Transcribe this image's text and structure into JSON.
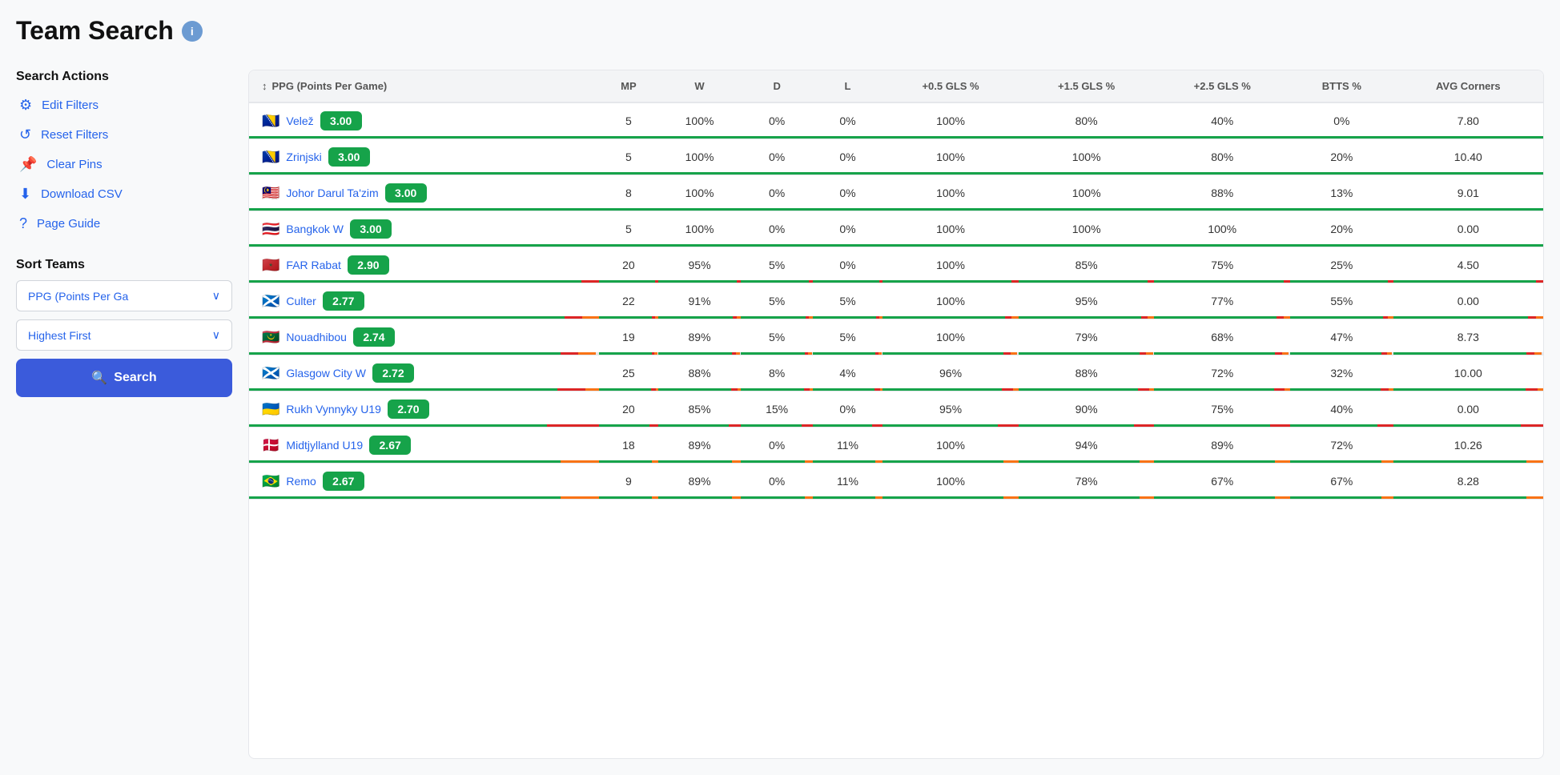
{
  "title": "Team Search",
  "info_icon_label": "i",
  "sidebar": {
    "search_actions_title": "Search Actions",
    "actions": [
      {
        "id": "edit-filters",
        "icon": "⚙",
        "label": "Edit Filters"
      },
      {
        "id": "reset-filters",
        "icon": "↺",
        "label": "Reset Filters"
      },
      {
        "id": "clear-pins",
        "icon": "📌",
        "label": "Clear Pins"
      },
      {
        "id": "download-csv",
        "icon": "⬇",
        "label": "Download CSV"
      },
      {
        "id": "page-guide",
        "icon": "?",
        "label": "Page Guide"
      }
    ],
    "sort_section_title": "Sort Teams",
    "sort_by_label": "PPG (Points Per Ga",
    "sort_order_label": "Highest First",
    "search_button_label": "Search"
  },
  "table": {
    "sort_col_icon": "↕",
    "sort_col_label": "PPG (Points Per Game)",
    "columns": [
      "MP",
      "W",
      "D",
      "L",
      "+0.5 GLS %",
      "+1.5 GLS %",
      "+2.5 GLS %",
      "BTTS %",
      "AVG Corners"
    ],
    "rows": [
      {
        "flag": "🇧🇦",
        "team": "Velež",
        "ppg": "3.00",
        "ppg_color": "green",
        "mp": "5",
        "w": "100%",
        "d": "0%",
        "l": "0%",
        "gls05": "100%",
        "gls15": "80%",
        "gls25": "40%",
        "btts": "0%",
        "avg_corners": "7.80",
        "bar_green": 100,
        "bar_red": 0,
        "bar_orange": 0
      },
      {
        "flag": "🇧🇦",
        "team": "Zrinjski",
        "ppg": "3.00",
        "ppg_color": "green",
        "mp": "5",
        "w": "100%",
        "d": "0%",
        "l": "0%",
        "gls05": "100%",
        "gls15": "100%",
        "gls25": "80%",
        "btts": "20%",
        "avg_corners": "10.40",
        "bar_green": 100,
        "bar_red": 0,
        "bar_orange": 0
      },
      {
        "flag": "🇲🇾",
        "team": "Johor Darul Ta'zim",
        "ppg": "3.00",
        "ppg_color": "green",
        "mp": "8",
        "w": "100%",
        "d": "0%",
        "l": "0%",
        "gls05": "100%",
        "gls15": "100%",
        "gls25": "88%",
        "btts": "13%",
        "avg_corners": "9.01",
        "bar_green": 100,
        "bar_red": 0,
        "bar_orange": 0
      },
      {
        "flag": "🇹🇭",
        "team": "Bangkok W",
        "ppg": "3.00",
        "ppg_color": "green",
        "mp": "5",
        "w": "100%",
        "d": "0%",
        "l": "0%",
        "gls05": "100%",
        "gls15": "100%",
        "gls25": "100%",
        "btts": "20%",
        "avg_corners": "0.00",
        "bar_green": 100,
        "bar_red": 0,
        "bar_orange": 0
      },
      {
        "flag": "🇲🇦",
        "team": "FAR Rabat",
        "ppg": "2.90",
        "ppg_color": "green",
        "mp": "20",
        "w": "95%",
        "d": "5%",
        "l": "0%",
        "gls05": "100%",
        "gls15": "85%",
        "gls25": "75%",
        "btts": "25%",
        "avg_corners": "4.50",
        "bar_green": 95,
        "bar_red": 5,
        "bar_orange": 0
      },
      {
        "flag": "🏴󠁧󠁢󠁳󠁣󠁴󠁿",
        "team": "Culter",
        "ppg": "2.77",
        "ppg_color": "green",
        "mp": "22",
        "w": "91%",
        "d": "5%",
        "l": "5%",
        "gls05": "100%",
        "gls15": "95%",
        "gls25": "77%",
        "btts": "55%",
        "avg_corners": "0.00",
        "bar_green": 91,
        "bar_red": 5,
        "bar_orange": 5
      },
      {
        "flag": "🇲🇷",
        "team": "Nouadhibou",
        "ppg": "2.74",
        "ppg_color": "green",
        "mp": "19",
        "w": "89%",
        "d": "5%",
        "l": "5%",
        "gls05": "100%",
        "gls15": "79%",
        "gls25": "68%",
        "btts": "47%",
        "avg_corners": "8.73",
        "bar_green": 89,
        "bar_red": 5,
        "bar_orange": 5
      },
      {
        "flag": "🏴󠁧󠁢󠁳󠁣󠁴󠁿",
        "team": "Glasgow City W",
        "ppg": "2.72",
        "ppg_color": "green",
        "mp": "25",
        "w": "88%",
        "d": "8%",
        "l": "4%",
        "gls05": "96%",
        "gls15": "88%",
        "gls25": "72%",
        "btts": "32%",
        "avg_corners": "10.00",
        "bar_green": 88,
        "bar_red": 8,
        "bar_orange": 4
      },
      {
        "flag": "🇺🇦",
        "team": "Rukh Vynnyky U19",
        "ppg": "2.70",
        "ppg_color": "green",
        "mp": "20",
        "w": "85%",
        "d": "15%",
        "l": "0%",
        "gls05": "95%",
        "gls15": "90%",
        "gls25": "75%",
        "btts": "40%",
        "avg_corners": "0.00",
        "bar_green": 85,
        "bar_red": 15,
        "bar_orange": 0
      },
      {
        "flag": "🇩🇰",
        "team": "Midtjylland U19",
        "ppg": "2.67",
        "ppg_color": "green",
        "mp": "18",
        "w": "89%",
        "d": "0%",
        "l": "11%",
        "gls05": "100%",
        "gls15": "94%",
        "gls25": "89%",
        "btts": "72%",
        "avg_corners": "10.26",
        "bar_green": 89,
        "bar_red": 0,
        "bar_orange": 11
      },
      {
        "flag": "🇧🇷",
        "team": "Remo",
        "ppg": "2.67",
        "ppg_color": "green",
        "mp": "9",
        "w": "89%",
        "d": "0%",
        "l": "11%",
        "gls05": "100%",
        "gls15": "78%",
        "gls25": "67%",
        "btts": "67%",
        "avg_corners": "8.28",
        "bar_green": 89,
        "bar_red": 0,
        "bar_orange": 11
      }
    ]
  }
}
